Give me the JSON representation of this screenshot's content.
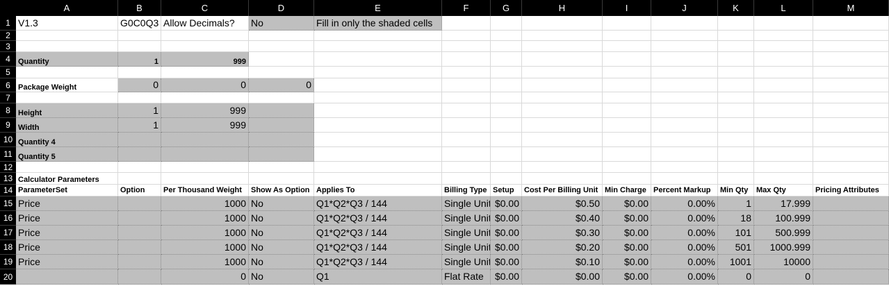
{
  "columns": [
    "A",
    "B",
    "C",
    "D",
    "E",
    "F",
    "G",
    "H",
    "I",
    "J",
    "K",
    "L",
    "M"
  ],
  "rows": [
    "1",
    "2",
    "3",
    "4",
    "5",
    "6",
    "7",
    "8",
    "9",
    "10",
    "11",
    "12",
    "13",
    "14",
    "15",
    "16",
    "17",
    "18",
    "19",
    "20"
  ],
  "r1": {
    "a": "V1.3",
    "b": "G0C0Q3",
    "c": "Allow Decimals?",
    "d": "No",
    "e": "Fill in only the shaded cells"
  },
  "r4": {
    "label": "Quantity",
    "b": "1",
    "c": "999"
  },
  "r6": {
    "label": "Package Weight",
    "b": "0",
    "c": "0",
    "d": "0"
  },
  "r8": {
    "label": "Height",
    "b": "1",
    "c": "999"
  },
  "r9": {
    "label": "Width",
    "b": "1",
    "c": "999"
  },
  "r10": {
    "label": "Quantity 4"
  },
  "r11": {
    "label": "Quantity 5"
  },
  "r13": {
    "label": "Calculator Parameters"
  },
  "headers": [
    "ParameterSet",
    "Option",
    "Per Thousand Weight",
    "Show As Option",
    "Applies To",
    "Billing Type",
    "Setup",
    "Cost Per Billing Unit",
    "Min Charge",
    "Percent Markup",
    "Min Qty",
    "Max Qty",
    "Pricing Attributes"
  ],
  "params": [
    [
      "Price",
      "",
      "1000",
      "No",
      "Q1*Q2*Q3 / 144",
      "Single Unit",
      "$0.00",
      "$0.50",
      "$0.00",
      "0.00%",
      "1",
      "17.999",
      ""
    ],
    [
      "Price",
      "",
      "1000",
      "No",
      "Q1*Q2*Q3 / 144",
      "Single Unit",
      "$0.00",
      "$0.40",
      "$0.00",
      "0.00%",
      "18",
      "100.999",
      ""
    ],
    [
      "Price",
      "",
      "1000",
      "No",
      "Q1*Q2*Q3 / 144",
      "Single Unit",
      "$0.00",
      "$0.30",
      "$0.00",
      "0.00%",
      "101",
      "500.999",
      ""
    ],
    [
      "Price",
      "",
      "1000",
      "No",
      "Q1*Q2*Q3 / 144",
      "Single Unit",
      "$0.00",
      "$0.20",
      "$0.00",
      "0.00%",
      "501",
      "1000.999",
      ""
    ],
    [
      "Price",
      "",
      "1000",
      "No",
      "Q1*Q2*Q3 / 144",
      "Single Unit",
      "$0.00",
      "$0.10",
      "$0.00",
      "0.00%",
      "1001",
      "10000",
      ""
    ],
    [
      "",
      "",
      "0",
      "No",
      "Q1",
      "Flat Rate",
      "$0.00",
      "$0.00",
      "$0.00",
      "0.00%",
      "0",
      "0",
      ""
    ]
  ]
}
